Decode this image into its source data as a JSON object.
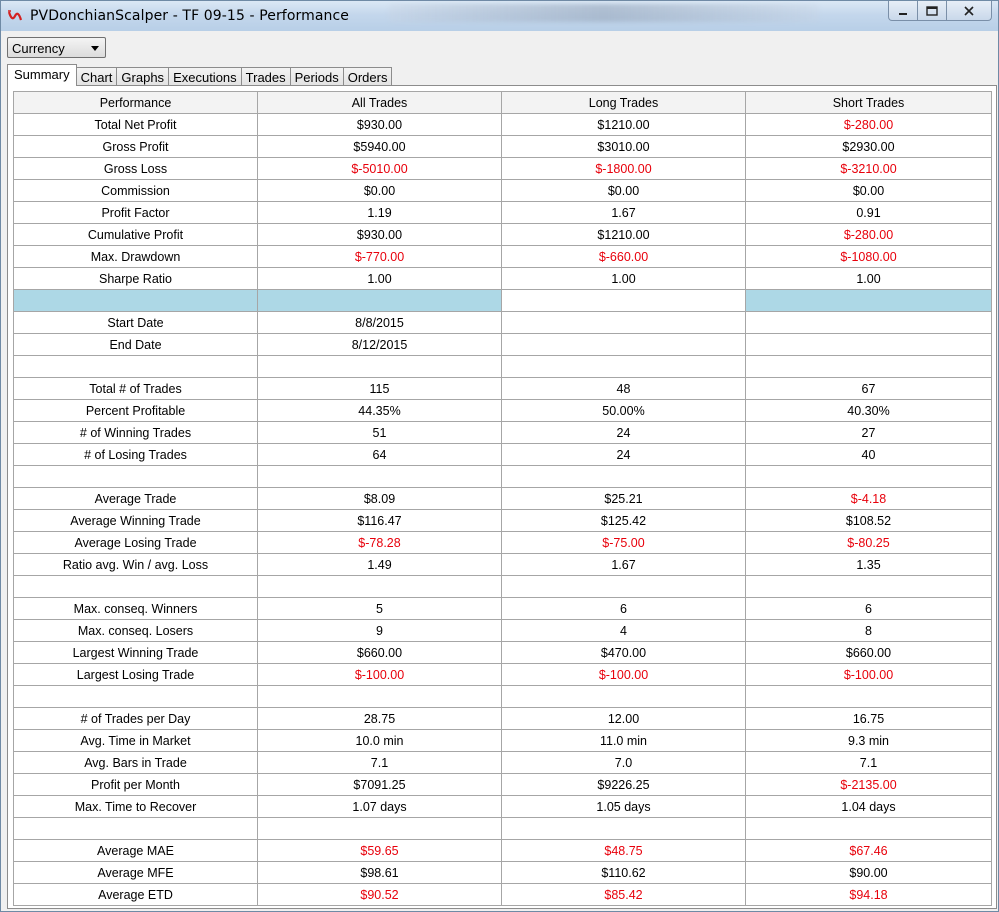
{
  "window": {
    "title": "PVDonchianScalper - TF 09-15 - Performance"
  },
  "currency_dropdown": {
    "value": "Currency"
  },
  "tabs": [
    {
      "label": "Summary",
      "active": true
    },
    {
      "label": "Chart",
      "active": false
    },
    {
      "label": "Graphs",
      "active": false
    },
    {
      "label": "Executions",
      "active": false
    },
    {
      "label": "Trades",
      "active": false
    },
    {
      "label": "Periods",
      "active": false
    },
    {
      "label": "Orders",
      "active": false
    }
  ],
  "colors": {
    "negative": "#e8000b",
    "highlight_row": "#add8e6"
  },
  "table": {
    "columns": [
      "Performance",
      "All Trades",
      "Long Trades",
      "Short Trades"
    ],
    "rows": [
      {
        "label": "Total Net Profit",
        "all": "$930.00",
        "long": "$1210.00",
        "short": "$-280.00"
      },
      {
        "label": "Gross Profit",
        "all": "$5940.00",
        "long": "$3010.00",
        "short": "$2930.00"
      },
      {
        "label": "Gross Loss",
        "all": "$-5010.00",
        "long": "$-1800.00",
        "short": "$-3210.00"
      },
      {
        "label": "Commission",
        "all": "$0.00",
        "long": "$0.00",
        "short": "$0.00"
      },
      {
        "label": "Profit Factor",
        "all": "1.19",
        "long": "1.67",
        "short": "0.91"
      },
      {
        "label": "Cumulative Profit",
        "all": "$930.00",
        "long": "$1210.00",
        "short": "$-280.00"
      },
      {
        "label": "Max. Drawdown",
        "all": "$-770.00",
        "long": "$-660.00",
        "short": "$-1080.00"
      },
      {
        "label": "Sharpe Ratio",
        "all": "1.00",
        "long": "1.00",
        "short": "1.00"
      },
      {
        "highlight": true,
        "label": "",
        "all": "",
        "long": "",
        "short": ""
      },
      {
        "label": "Start Date",
        "all": "8/8/2015",
        "long": "",
        "short": ""
      },
      {
        "label": "End Date",
        "all": "8/12/2015",
        "long": "",
        "short": ""
      },
      {
        "label": "",
        "all": "",
        "long": "",
        "short": ""
      },
      {
        "label": "Total # of Trades",
        "all": "115",
        "long": "48",
        "short": "67"
      },
      {
        "label": "Percent Profitable",
        "all": "44.35%",
        "long": "50.00%",
        "short": "40.30%"
      },
      {
        "label": "# of Winning Trades",
        "all": "51",
        "long": "24",
        "short": "27"
      },
      {
        "label": "# of Losing Trades",
        "all": "64",
        "long": "24",
        "short": "40"
      },
      {
        "label": "",
        "all": "",
        "long": "",
        "short": ""
      },
      {
        "label": "Average Trade",
        "all": "$8.09",
        "long": "$25.21",
        "short": "$-4.18"
      },
      {
        "label": "Average Winning Trade",
        "all": "$116.47",
        "long": "$125.42",
        "short": "$108.52"
      },
      {
        "label": "Average Losing Trade",
        "all": "$-78.28",
        "long": "$-75.00",
        "short": "$-80.25"
      },
      {
        "label": "Ratio avg. Win / avg. Loss",
        "all": "1.49",
        "long": "1.67",
        "short": "1.35"
      },
      {
        "label": "",
        "all": "",
        "long": "",
        "short": ""
      },
      {
        "label": "Max. conseq. Winners",
        "all": "5",
        "long": "6",
        "short": "6"
      },
      {
        "label": "Max. conseq. Losers",
        "all": "9",
        "long": "4",
        "short": "8"
      },
      {
        "label": "Largest Winning Trade",
        "all": "$660.00",
        "long": "$470.00",
        "short": "$660.00"
      },
      {
        "label": "Largest Losing Trade",
        "all": "$-100.00",
        "long": "$-100.00",
        "short": "$-100.00"
      },
      {
        "label": "",
        "all": "",
        "long": "",
        "short": ""
      },
      {
        "label": "# of Trades per Day",
        "all": "28.75",
        "long": "12.00",
        "short": "16.75"
      },
      {
        "label": "Avg. Time in Market",
        "all": "10.0 min",
        "long": "11.0 min",
        "short": "9.3 min"
      },
      {
        "label": "Avg. Bars in Trade",
        "all": "7.1",
        "long": "7.0",
        "short": "7.1"
      },
      {
        "label": "Profit per Month",
        "all": "$7091.25",
        "long": "$9226.25",
        "short": "$-2135.00"
      },
      {
        "label": "Max. Time to Recover",
        "all": "1.07 days",
        "long": "1.05 days",
        "short": "1.04 days"
      },
      {
        "label": "",
        "all": "",
        "long": "",
        "short": ""
      },
      {
        "label": "Average MAE",
        "all": "$59.65",
        "long": "$48.75",
        "short": "$67.46",
        "red": true
      },
      {
        "label": "Average MFE",
        "all": "$98.61",
        "long": "$110.62",
        "short": "$90.00"
      },
      {
        "label": "Average ETD",
        "all": "$90.52",
        "long": "$85.42",
        "short": "$94.18",
        "red": true
      }
    ]
  }
}
